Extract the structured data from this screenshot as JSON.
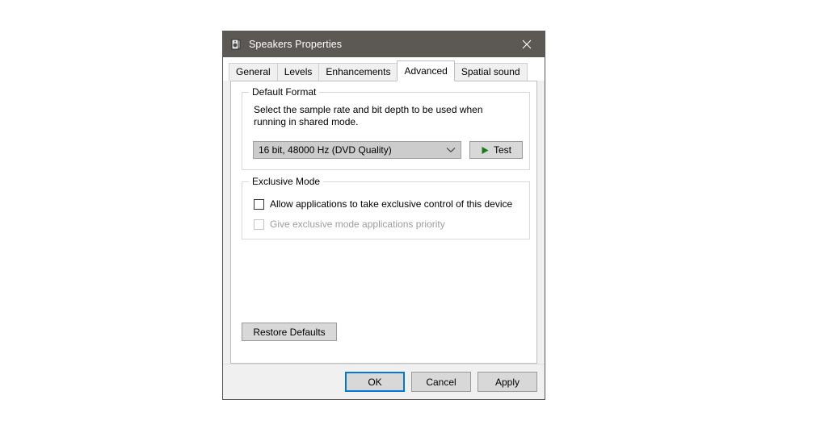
{
  "window": {
    "title": "Speakers Properties",
    "icon": "speaker-device-icon",
    "close_label": "×",
    "titlebar_color": "#5c5954"
  },
  "tabs": [
    {
      "label": "General",
      "selected": false
    },
    {
      "label": "Levels",
      "selected": false
    },
    {
      "label": "Enhancements",
      "selected": false
    },
    {
      "label": "Advanced",
      "selected": true
    },
    {
      "label": "Spatial sound",
      "selected": false
    }
  ],
  "default_format": {
    "legend": "Default Format",
    "description": "Select the sample rate and bit depth to be used when running in shared mode.",
    "selected_option": "16 bit, 48000 Hz (DVD Quality)",
    "dropdown_icon": "chevron-down-icon",
    "test_button": {
      "label": "Test",
      "icon": "play-triangle-icon",
      "icon_color": "#1a7a1a"
    }
  },
  "exclusive_mode": {
    "legend": "Exclusive Mode",
    "options": [
      {
        "label": "Allow applications to take exclusive control of this device",
        "checked": false,
        "disabled": false
      },
      {
        "label": "Give exclusive mode applications priority",
        "checked": false,
        "disabled": true
      }
    ]
  },
  "restore_defaults": {
    "label": "Restore Defaults"
  },
  "footer": {
    "ok_label": "OK",
    "cancel_label": "Cancel",
    "apply_label": "Apply",
    "default_focus_color": "#0078d7"
  }
}
